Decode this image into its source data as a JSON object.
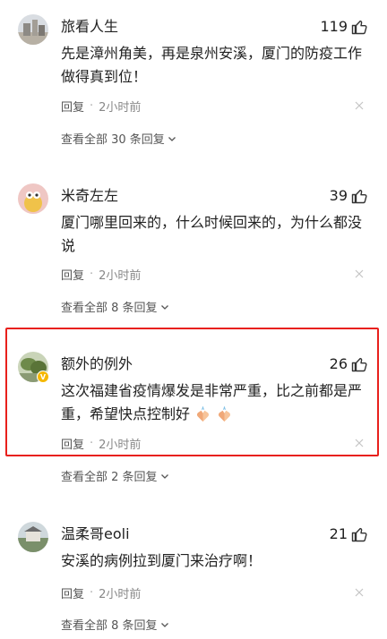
{
  "comments": [
    {
      "username": "旅看人生",
      "likes": "119",
      "text": "先是漳州角美，再是泉州安溪，厦门的防疫工作做得真到位！",
      "reply_label": "回复",
      "time": "2小时前",
      "more_replies": "查看全部 30 条回复"
    },
    {
      "username": "米奇左左",
      "likes": "39",
      "text": "厦门哪里回来的，什么时候回来的，为什么都没说",
      "reply_label": "回复",
      "time": "2小时前",
      "more_replies": "查看全部 8 条回复"
    },
    {
      "username": "额外的例外",
      "likes": "26",
      "text": "这次福建省疫情爆发是非常严重，比之前都是严重，希望快点控制好",
      "reply_label": "回复",
      "time": "2小时前",
      "more_replies": "查看全部 2 条回复",
      "badge": "V",
      "highlighted": true
    },
    {
      "username": "温柔哥eoli",
      "likes": "21",
      "text": "安溪的病例拉到厦门来治疗啊！",
      "reply_label": "回复",
      "time": "2小时前",
      "more_replies": "查看全部 8 条回复"
    }
  ],
  "colors": {
    "text": "#222222",
    "meta": "#888888",
    "highlight_border": "#e8201c",
    "badge": "#f5b800"
  },
  "icons": [
    "thumbs-up-icon",
    "close-icon",
    "chevron-down-icon",
    "pray-hands-emoji",
    "verified-badge"
  ]
}
